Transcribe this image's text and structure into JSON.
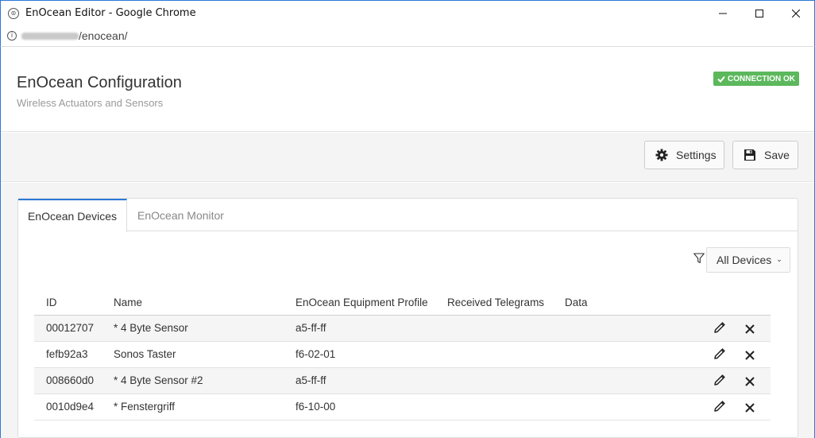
{
  "window": {
    "title": "EnOcean Editor - Google Chrome",
    "url_path": "/enocean/"
  },
  "header": {
    "title": "EnOcean Configuration",
    "subtitle": "Wireless Actuators and Sensors",
    "status_badge": "CONNECTION OK",
    "status_color": "#5cb85c"
  },
  "toolbar": {
    "settings_label": "Settings",
    "save_label": "Save"
  },
  "tabs": [
    {
      "label": "EnOcean Devices",
      "active": true
    },
    {
      "label": "EnOcean Monitor",
      "active": false
    }
  ],
  "filter": {
    "selected": "All Devices"
  },
  "table": {
    "columns": [
      "ID",
      "Name",
      "EnOcean Equipment Profile",
      "Received Telegrams",
      "Data"
    ],
    "rows": [
      {
        "id": "00012707",
        "name": "* 4 Byte Sensor",
        "eep": "a5-ff-ff",
        "telegrams": "",
        "data": ""
      },
      {
        "id": "fefb92a3",
        "name": "Sonos Taster",
        "eep": "f6-02-01",
        "telegrams": "",
        "data": ""
      },
      {
        "id": "008660d0",
        "name": "* 4 Byte Sensor #2",
        "eep": "a5-ff-ff",
        "telegrams": "",
        "data": ""
      },
      {
        "id": "0010d9e4",
        "name": "* Fenstergriff",
        "eep": "f6-10-00",
        "telegrams": "",
        "data": ""
      }
    ]
  },
  "accent_color": "#2b79d8"
}
